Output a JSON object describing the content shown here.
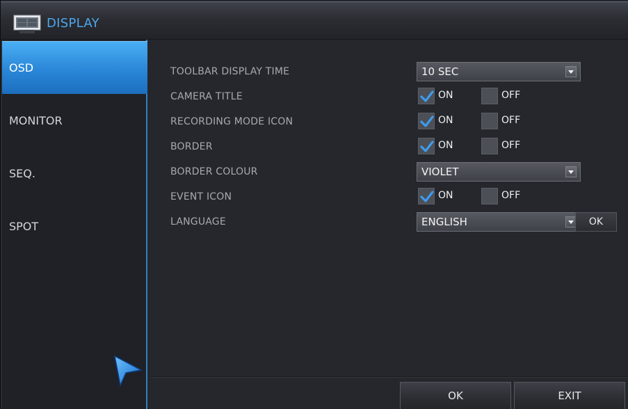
{
  "window": {
    "title": "DISPLAY",
    "icon": "monitor-icon"
  },
  "sidebar": {
    "items": [
      {
        "label": "OSD",
        "active": true
      },
      {
        "label": "MONITOR",
        "active": false
      },
      {
        "label": "SEQ.",
        "active": false
      },
      {
        "label": "SPOT",
        "active": false
      }
    ],
    "cursor_icon": "pointer-arrow-icon"
  },
  "settings": {
    "toolbar_display_time": {
      "label": "TOOLBAR DISPLAY TIME",
      "value": "10 SEC"
    },
    "camera_title": {
      "label": "CAMERA TITLE",
      "on_label": "ON",
      "off_label": "OFF",
      "on": true
    },
    "recording_mode_icon": {
      "label": "RECORDING MODE ICON",
      "on_label": "ON",
      "off_label": "OFF",
      "on": true
    },
    "border": {
      "label": "BORDER",
      "on_label": "ON",
      "off_label": "OFF",
      "on": true
    },
    "border_colour": {
      "label": "BORDER COLOUR",
      "value": "VIOLET"
    },
    "event_icon": {
      "label": "EVENT ICON",
      "on_label": "ON",
      "off_label": "OFF",
      "on": true
    },
    "language": {
      "label": "LANGUAGE",
      "value": "ENGLISH",
      "ok_label": "OK"
    }
  },
  "footer": {
    "ok_label": "OK",
    "exit_label": "EXIT"
  },
  "colors": {
    "accent": "#2f8ee0",
    "title_text": "#4da6ea",
    "check": "#3d9cf0"
  }
}
